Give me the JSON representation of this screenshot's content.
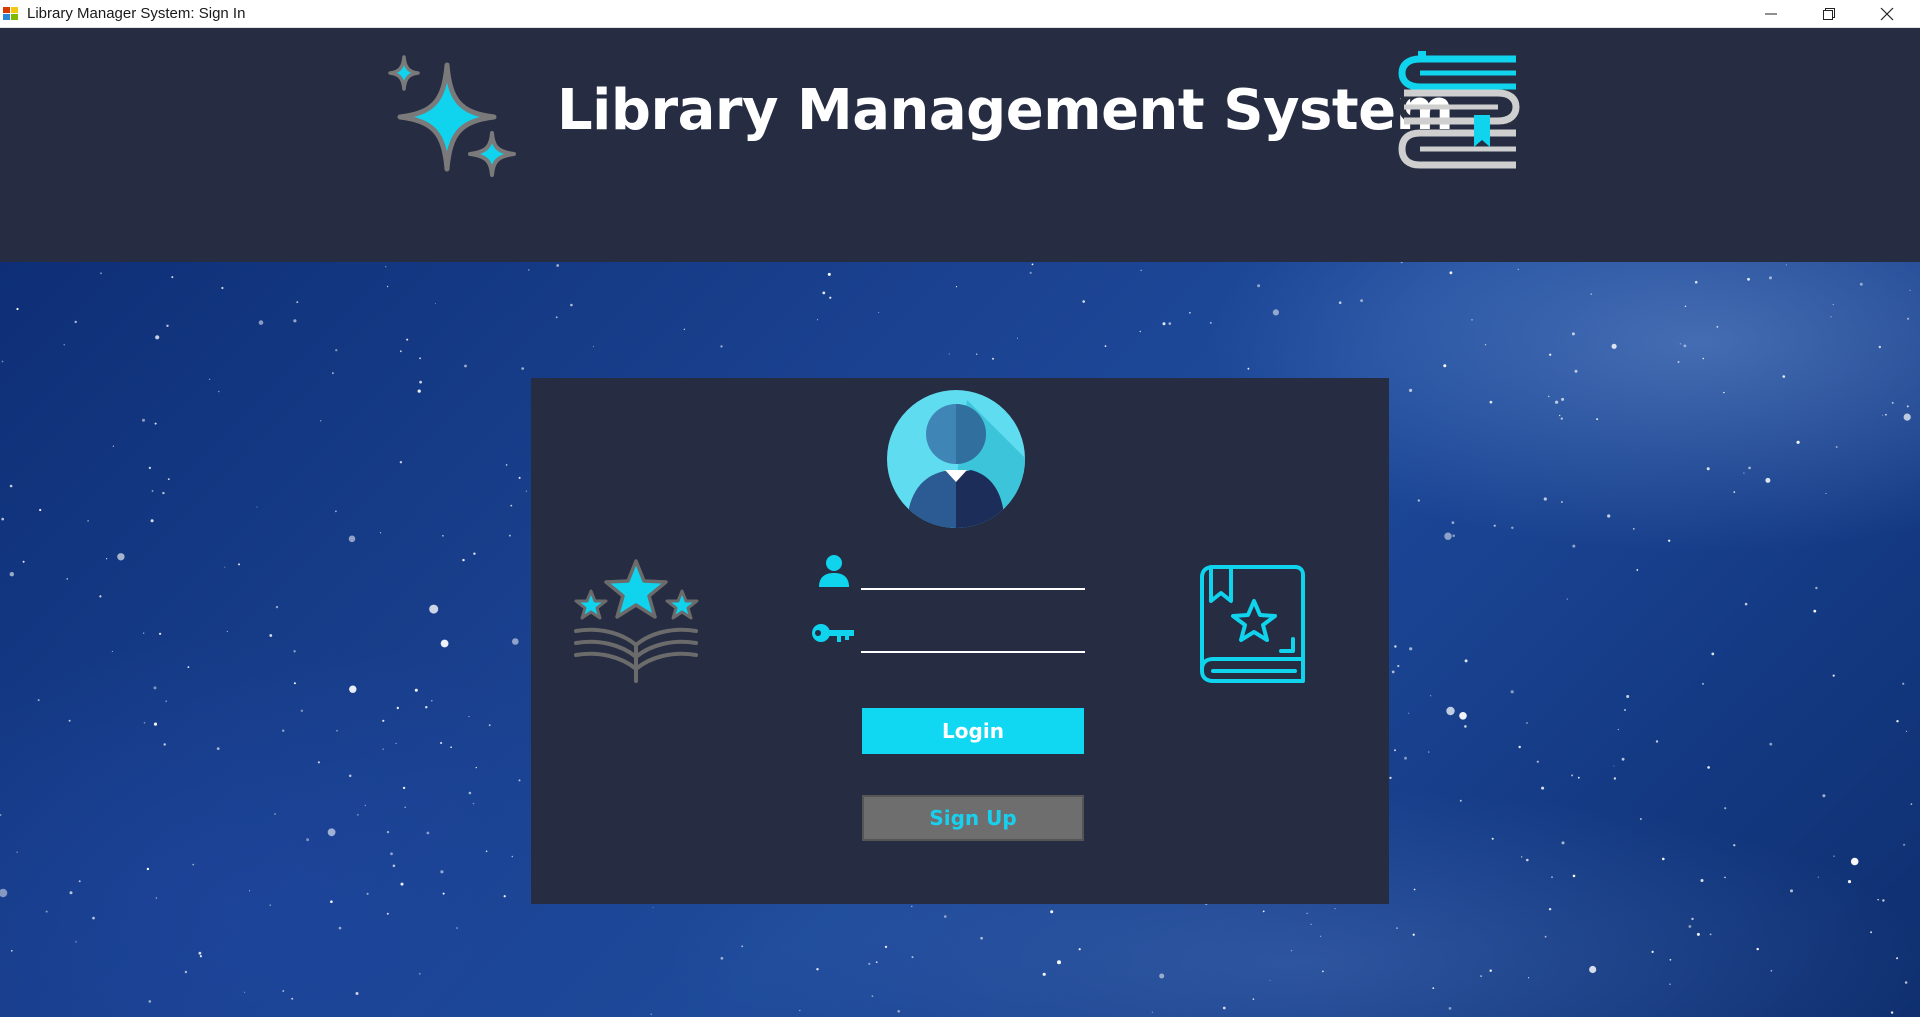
{
  "window": {
    "title": "Library Manager System: Sign In",
    "controls": [
      "minimize-icon",
      "restore-icon",
      "close-icon"
    ]
  },
  "header": {
    "title": "Library Management System",
    "left_icon": "sparkles-icon",
    "right_icon": "stacked-books-icon"
  },
  "login_form": {
    "avatar_icon": "user-avatar-icon",
    "left_icon": "stars-over-book-icon",
    "right_icon": "favorite-book-icon",
    "username": {
      "icon": "user-icon",
      "value": "",
      "placeholder": ""
    },
    "password": {
      "icon": "key-icon",
      "value": "",
      "placeholder": ""
    },
    "login_label": "Login",
    "signup_label": "Sign Up"
  },
  "colors": {
    "accent": "#10d8f2",
    "panel_bg": "#262c41",
    "header_bg": "#262c41",
    "secondary_button": "#6e6e6e",
    "icon_gray": "#6b6b6b"
  }
}
